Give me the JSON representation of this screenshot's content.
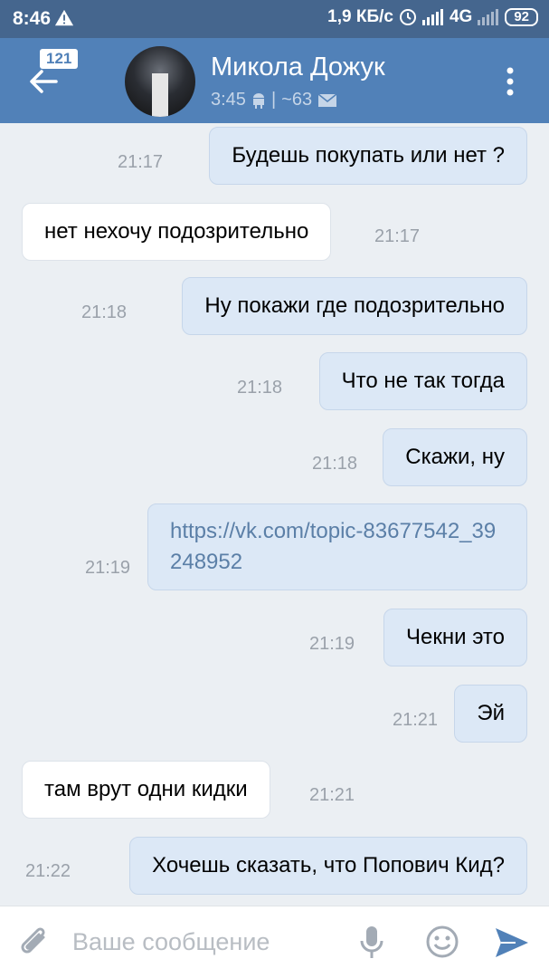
{
  "status_bar": {
    "time": "8:46",
    "speed": "1,9 КБ/с",
    "network": "4G",
    "battery": "92"
  },
  "header": {
    "unread_count": "121",
    "name": "Микола Дожук",
    "last_seen": "3:45",
    "separator": "|",
    "messages": "~63"
  },
  "messages": [
    {
      "dir": "out",
      "text": "Будешь покупать или нет ?",
      "time": "21:17"
    },
    {
      "dir": "in",
      "text": "нет нехочу подозрительно",
      "time": "21:17"
    },
    {
      "dir": "out",
      "text": "Ну покажи где подозрительно",
      "time": "21:18"
    },
    {
      "dir": "out",
      "text": "Что не так тогда",
      "time": "21:18"
    },
    {
      "dir": "out",
      "text": "Скажи, ну",
      "time": "21:18"
    },
    {
      "dir": "out",
      "text": "https://vk.com/topic-83677542_39248952",
      "time": "21:19"
    },
    {
      "dir": "out",
      "text": "Чекни это",
      "time": "21:19"
    },
    {
      "dir": "out",
      "text": "Эй",
      "time": "21:21"
    },
    {
      "dir": "in",
      "text": "там врут одни кидки",
      "time": "21:21"
    },
    {
      "dir": "out",
      "text": "Хочешь сказать, что Попович Кид?",
      "time": "21:22"
    }
  ],
  "composer": {
    "placeholder": "Ваше сообщение"
  },
  "colors": {
    "status_bar": "#45668e",
    "header": "#5181b8",
    "outgoing_bubble": "#dce8f6",
    "incoming_bubble": "#ffffff",
    "chat_background": "#ebeff3",
    "link": "#5b7fa7"
  },
  "icons": [
    "warning-icon",
    "clock-icon",
    "signal-icon",
    "battery-icon",
    "back-arrow-icon",
    "android-icon",
    "mail-icon",
    "more-vert-icon",
    "paperclip-icon",
    "microphone-icon",
    "emoji-icon",
    "send-icon"
  ]
}
